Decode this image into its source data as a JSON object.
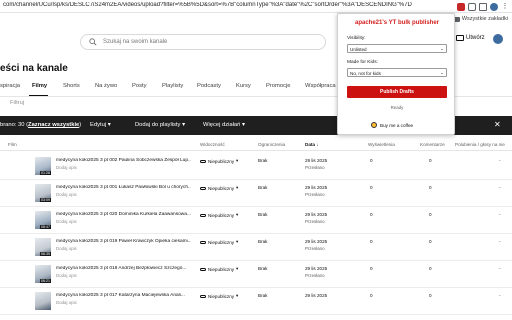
{
  "browser": {
    "url": "com/channel/UCu/Isp/ks/DESLC7iS24m2EA/videos/upload?filter=%5B%5D&sort=%7B\"columnType\"%3A\"date\"%2C\"sortOrder\"%3A\"DESCENDING\"%7D",
    "bookmarks_folder": "Wszystkie zakładki"
  },
  "header": {
    "search_placeholder": "Szukaj na swoim kanale",
    "create_label": "Utwórz"
  },
  "page": {
    "title": "eści na kanale"
  },
  "tabs": [
    {
      "label": "spiracja"
    },
    {
      "label": "Filmy"
    },
    {
      "label": "Shorts"
    },
    {
      "label": "Na żywo"
    },
    {
      "label": "Posty"
    },
    {
      "label": "Playlisty"
    },
    {
      "label": "Podcasty"
    },
    {
      "label": "Kursy"
    },
    {
      "label": "Promocje"
    },
    {
      "label": "Współpraca"
    }
  ],
  "filter": {
    "label": "Filtruj"
  },
  "selection": {
    "count_text": "brano: 30 (",
    "select_all": "Zaznacz wszystkie",
    "count_close": ")",
    "edit": "Edytuj",
    "add_to_playlist": "Dodaj do playlisty",
    "more_actions": "Więcej działań"
  },
  "table": {
    "headers": {
      "video": "Film",
      "visibility": "Widoczność",
      "restrictions": "Ograniczenia",
      "date": "Data",
      "views": "Wyświetlenia",
      "comments": "Komentarze",
      "likes": "Polubienia / głosy na nie"
    },
    "rows": [
      {
        "title": "medycyna koło2025 3 pt 002 Paulina Sobczewska Zespół Lup...",
        "desc": "Dodaj opis",
        "duration": "01:28",
        "visibility": "Niepubliczny",
        "restrictions": "Brak",
        "date": "29 lis 2025",
        "status": "Przesłano",
        "views": "0",
        "comments": "0",
        "likes": "-"
      },
      {
        "title": "medycyna koło2025 3 pt 001 Łukasz Pawłowski Ból u chorych...",
        "desc": "Dodaj opis",
        "duration": "03:09",
        "visibility": "Niepubliczny",
        "restrictions": "Brak",
        "date": "29 lis 2025",
        "status": "Przesłano",
        "views": "0",
        "comments": "0",
        "likes": "-"
      },
      {
        "title": "medycyna koło2025 3 pt 020 Dominika Kurkiela Zaawansowa...",
        "desc": "Dodaj opis",
        "duration": "08:47",
        "visibility": "Niepubliczny",
        "restrictions": "Brak",
        "date": "29 lis 2025",
        "status": "Przesłano",
        "views": "0",
        "comments": "0",
        "likes": "-"
      },
      {
        "title": "medycyna koło2025 3 pt 019 Paweł Krawczyk Opieka ciesami...",
        "desc": "Dodaj opis",
        "duration": "06:35",
        "visibility": "Niepubliczny",
        "restrictions": "Brak",
        "date": "29 lis 2025",
        "status": "Przesłano",
        "views": "0",
        "comments": "0",
        "likes": "-"
      },
      {
        "title": "medycyna koło2025 3 pt 018 Andrzej Bezpłowiecz Szczegó...",
        "desc": "Dodaj opis",
        "duration": "06:21",
        "visibility": "Niepubliczny",
        "restrictions": "Brak",
        "date": "29 lis 2025",
        "status": "Przesłano",
        "views": "0",
        "comments": "0",
        "likes": "-"
      },
      {
        "title": "medycyna koło2025 3 pt 017 Katarzyna Maciejewska Anali...",
        "desc": "Dodaj opis",
        "duration": "",
        "visibility": "Niepubliczny",
        "restrictions": "Brak",
        "date": "29 lis 2025",
        "status": "",
        "views": "0",
        "comments": "0",
        "likes": "-"
      }
    ]
  },
  "popup": {
    "title": "apache21's YT bulk publisher",
    "visibility_label": "Visibility:",
    "visibility_value": "Unlisted",
    "kids_label": "Made for Kids:",
    "kids_value": "No, not for kids",
    "publish_label": "Publish Drafts",
    "status": "Ready",
    "coffee_label": "Buy me a coffee"
  },
  "colors": {
    "accent_red": "#cc1111",
    "popup_title": "#d32020",
    "toolbar_dark": "#1f1f1f"
  }
}
